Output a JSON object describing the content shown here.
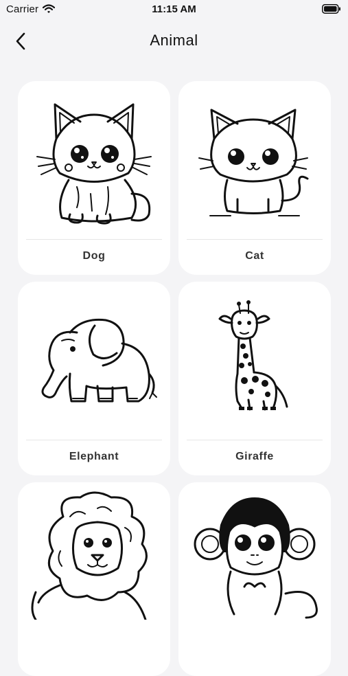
{
  "status_bar": {
    "carrier": "Carrier",
    "time": "11:15 AM"
  },
  "nav": {
    "title": "Animal"
  },
  "animals": [
    {
      "label": "Dog",
      "icon": "cat-like-dog-illustration"
    },
    {
      "label": "Cat",
      "icon": "cat-illustration"
    },
    {
      "label": "Elephant",
      "icon": "elephant-illustration"
    },
    {
      "label": "Giraffe",
      "icon": "giraffe-illustration"
    },
    {
      "label": "",
      "icon": "lion-illustration"
    },
    {
      "label": "",
      "icon": "monkey-illustration"
    }
  ],
  "colors": {
    "background": "#f4f4f6",
    "card": "#ffffff",
    "text": "#111111"
  }
}
